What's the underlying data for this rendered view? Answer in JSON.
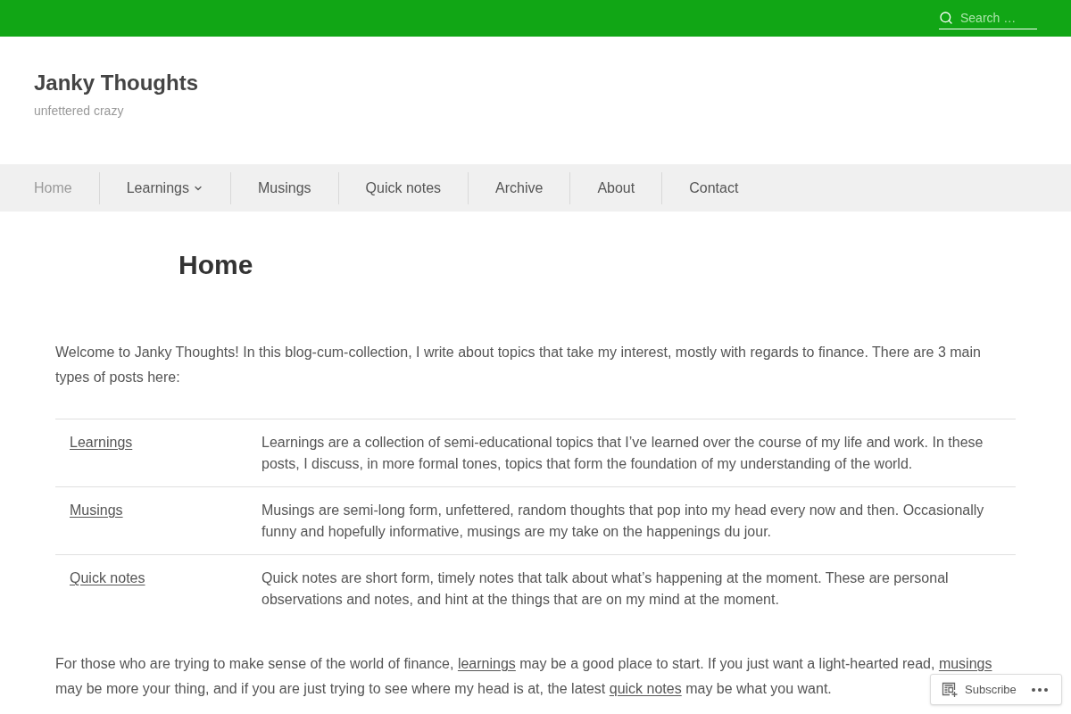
{
  "top_bar": {
    "search": {
      "placeholder": "Search …"
    }
  },
  "site": {
    "title": "Janky Thoughts",
    "tagline": "unfettered crazy"
  },
  "nav": {
    "items": [
      {
        "label": "Home",
        "selected": true,
        "dropdown": false
      },
      {
        "label": "Learnings",
        "selected": false,
        "dropdown": true
      },
      {
        "label": "Musings",
        "selected": false,
        "dropdown": false
      },
      {
        "label": "Quick notes",
        "selected": false,
        "dropdown": false
      },
      {
        "label": "Archive",
        "selected": false,
        "dropdown": false
      },
      {
        "label": "About",
        "selected": false,
        "dropdown": false
      },
      {
        "label": "Contact",
        "selected": false,
        "dropdown": false
      }
    ]
  },
  "page": {
    "title": "Home",
    "intro": "Welcome to Janky Thoughts! In this blog-cum-collection, I write about topics that take my interest, mostly with regards to finance. There are 3 main types of posts here:",
    "table": {
      "rows": [
        {
          "term": "Learnings",
          "description": "Learnings are a collection of semi-educational topics that I’ve learned over the course of my life and work. In these posts, I discuss, in more formal tones, topics that form the foundation of my understanding of the world."
        },
        {
          "term": "Musings",
          "description": "Musings are semi-long form, unfettered, random thoughts that pop into my head every now and then. Occasionally funny and hopefully informative, musings are my take on the happenings du jour."
        },
        {
          "term": "Quick notes",
          "description": "Quick notes are short form, timely notes that talk about what’s happening at the moment. These are personal observations and notes, and hint at the things that are on my mind at the moment."
        }
      ]
    },
    "closing": [
      {
        "kind": "text",
        "text": "For those who are trying to make sense of the world of finance, "
      },
      {
        "kind": "link",
        "text": "learnings"
      },
      {
        "kind": "text",
        "text": " may be a good place to start. If you just want a light-hearted read, "
      },
      {
        "kind": "link",
        "text": "musings"
      },
      {
        "kind": "text",
        "text": " may be more your thing, and if you are just trying to see where my head is at, the latest "
      },
      {
        "kind": "link",
        "text": "quick notes"
      },
      {
        "kind": "text",
        "text": " may be what you want."
      }
    ]
  },
  "subscribe_widget": {
    "button": "Subscribe"
  }
}
